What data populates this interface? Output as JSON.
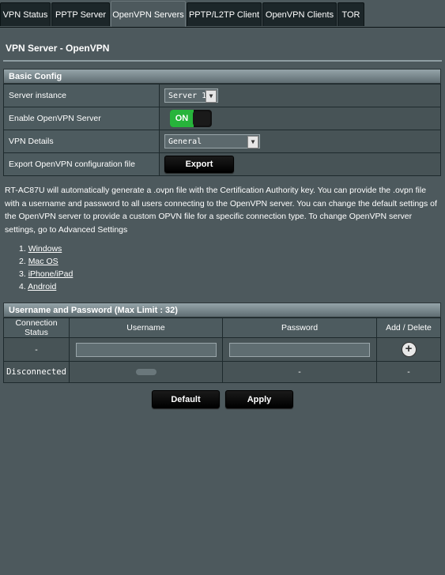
{
  "tabs": [
    {
      "label": "VPN Status"
    },
    {
      "label": "PPTP Server"
    },
    {
      "label": "OpenVPN Servers"
    },
    {
      "label": "PPTP/L2TP Client"
    },
    {
      "label": "OpenVPN Clients"
    },
    {
      "label": "TOR"
    }
  ],
  "active_tab": "OpenVPN Servers",
  "page_title": "VPN Server - OpenVPN",
  "basic_config": {
    "header": "Basic Config",
    "server_instance_label": "Server instance",
    "server_instance_value": "Server 1",
    "enable_label": "Enable OpenVPN Server",
    "enable_value": "ON",
    "vpn_details_label": "VPN Details",
    "vpn_details_value": "General",
    "export_label": "Export OpenVPN configuration file",
    "export_button": "Export"
  },
  "description": "RT-AC87U will automatically generate a .ovpn file with the Certification Authority key. You can provide the .ovpn file with a username and password to all users connecting to the OpenVPN server. You can change the default settings of the OpenVPN server to provide a custom OPVN file for a specific connection type. To change OpenVPN server settings, go to Advanced Settings",
  "os_links": [
    {
      "num": "1.",
      "label": "Windows"
    },
    {
      "num": "2.",
      "label": "Mac OS"
    },
    {
      "num": "3.",
      "label": "iPhone/iPad"
    },
    {
      "num": "4.",
      "label": "Android"
    }
  ],
  "users": {
    "header": "Username and Password (Max Limit : 32)",
    "columns": [
      "Connection Status",
      "Username",
      "Password",
      "Add / Delete"
    ],
    "new_row_status": "-",
    "rows": [
      {
        "status": "Disconnected",
        "username": "",
        "password": "-",
        "action": "-"
      }
    ]
  },
  "buttons": {
    "default": "Default",
    "apply": "Apply"
  },
  "colors": {
    "background": "#4d595d",
    "toggle_on": "#27b43b",
    "tab_bg": "#1c2629"
  }
}
